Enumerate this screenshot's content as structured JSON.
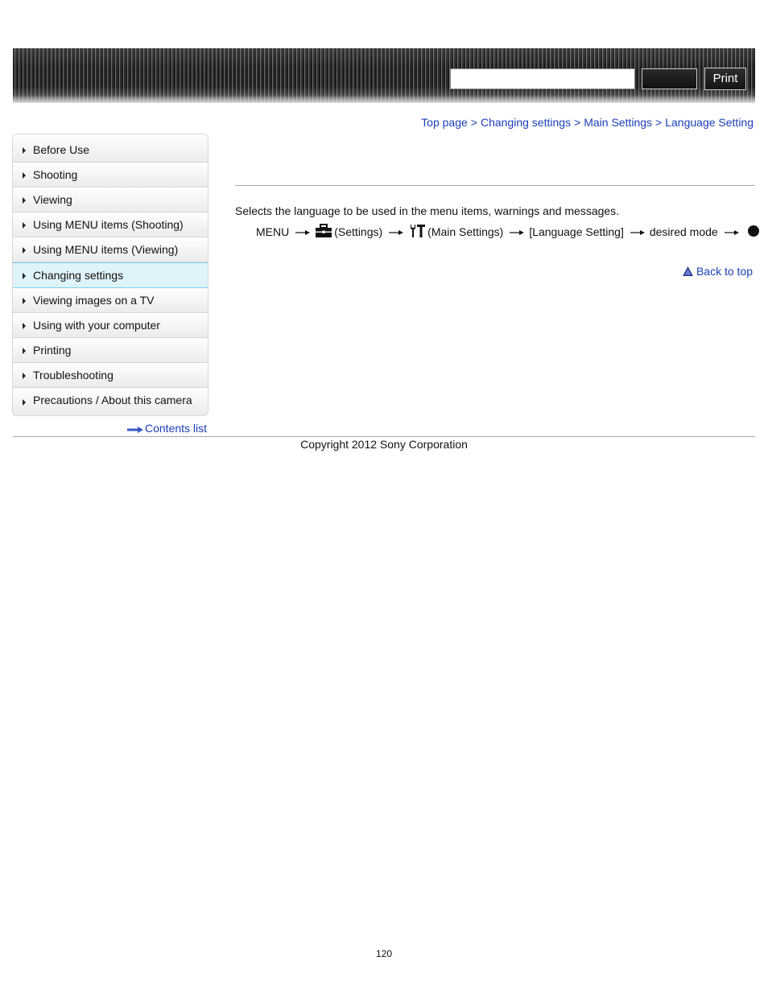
{
  "header": {
    "search": {
      "value": "",
      "placeholder": ""
    },
    "search_button_label": "",
    "print_label": "Print"
  },
  "breadcrumb": {
    "items": [
      "Top page",
      "Changing settings",
      "Main Settings",
      "Language Setting"
    ],
    "separator": ">"
  },
  "sidebar": {
    "items": [
      {
        "label": "Before Use",
        "active": false
      },
      {
        "label": "Shooting",
        "active": false
      },
      {
        "label": "Viewing",
        "active": false
      },
      {
        "label": "Using MENU items (Shooting)",
        "active": false
      },
      {
        "label": "Using MENU items (Viewing)",
        "active": false
      },
      {
        "label": "Changing settings",
        "active": true
      },
      {
        "label": "Viewing images on a TV",
        "active": false
      },
      {
        "label": "Using with your computer",
        "active": false
      },
      {
        "label": "Printing",
        "active": false
      },
      {
        "label": "Troubleshooting",
        "active": false
      },
      {
        "label": "Precautions / About this camera",
        "active": false
      }
    ],
    "contents_list_label": "Contents list"
  },
  "main": {
    "description": "Selects the language to be used in the menu items, warnings and messages.",
    "steps": {
      "menu": "MENU",
      "settings": "(Settings)",
      "main_settings": "(Main Settings)",
      "language_setting": "[Language Setting]",
      "desired_mode": "desired mode"
    },
    "back_to_top_label": "Back to top"
  },
  "footer": {
    "copyright": "Copyright 2012 Sony Corporation",
    "page_number": "120"
  },
  "colors": {
    "link": "#1a3db8",
    "active_nav_bg": "#dff3fb",
    "active_nav_border": "#7fd4ef"
  }
}
